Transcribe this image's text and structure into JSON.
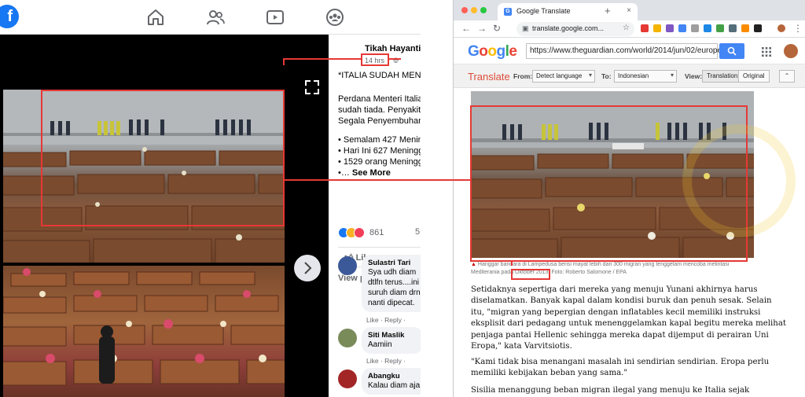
{
  "facebook": {
    "author": "Tikah Hayanti",
    "time": "14 hrs",
    "post_lines": [
      "*ITALIA SUDAH MENT",
      "",
      "Perdana Menteri Italia",
      "sudah tiada. Penyakit",
      "Segala Penyembuhan",
      "",
      "• Semalam 427 Menin",
      "• Hari Ini 627 Meningg",
      "• 1529 orang Meningg",
      "•…"
    ],
    "see_more": "See More",
    "reaction_count": "861",
    "share_count": "5",
    "like_label": "Like",
    "view_previous": "View previous comm",
    "comments": [
      {
        "name": "Sulastri Tari",
        "lines": [
          "Sya udh diam",
          "dtlfn terus....ini",
          "suruh diam drn",
          "nanti dipecat."
        ],
        "actions": "Like · Reply ·"
      },
      {
        "name": "Siti Maslik",
        "lines": [
          "Aamiin"
        ],
        "actions": "Like · Reply ·"
      },
      {
        "name": "Abangku",
        "lines": [
          "Kalau diam aja"
        ],
        "actions": ""
      }
    ]
  },
  "chrome": {
    "tab_title": "Google Translate",
    "tab_close": "×",
    "new_tab": "+",
    "url": "translate.google.com..."
  },
  "translate": {
    "logo": [
      {
        "ch": "G",
        "color": "#4285f4"
      },
      {
        "ch": "o",
        "color": "#ea4335"
      },
      {
        "ch": "o",
        "color": "#fbbc05"
      },
      {
        "ch": "g",
        "color": "#4285f4"
      },
      {
        "ch": "l",
        "color": "#34a853"
      },
      {
        "ch": "e",
        "color": "#ea4335"
      }
    ],
    "source_url": "https://www.theguardian.com/world/2014/jun/02/europe-re",
    "brand": "Translate",
    "from_label": "From:",
    "from_value": "Detect language",
    "to_label": "To:",
    "to_value": "Indonesian",
    "view_label": "View:",
    "translation_btn": "Translation",
    "original_btn": "Original",
    "collapse_icon": "⌃",
    "caption_line1": "Hanggar bandara di Lampedusa berisi mayat lebih dari 300 migran yang tenggelam mencoba melintasi",
    "caption_line2_prefix": "Mediterania pada ",
    "caption_date": "Oktober 2013",
    "caption_line2_suffix": ". Foto: Roberto Salomone / EPA",
    "paragraphs": [
      [
        "Setidaknya sepertiga dari mereka yang menuju Yunani akhirnya harus",
        "diselamatkan. Banyak kapal dalam kondisi buruk dan penuh sesak. Selain",
        "itu, \"migran yang bepergian dengan inflatables kecil memiliki instruksi",
        "eksplisit dari pedagang untuk menenggelamkan kapal begitu mereka melihat",
        "penjaga pantai Hellenic sehingga mereka dapat dijemput di perairan Uni",
        "Eropa,\" kata Varvitsiotis."
      ],
      [
        "\"Kami tidak bisa menangani masalah ini sendirian sendirian. Eropa perlu",
        "memiliki kebijakan beban yang sama.\""
      ],
      [
        "Sisilia menanggung beban migran ilegal yang menuju ke Italia sejak"
      ]
    ]
  },
  "colors": {
    "fb_blue": "#1877f2",
    "highlight_red": "#e53935",
    "google_blue": "#4285f4",
    "translate_red": "#dd4b39",
    "watermark": "#f0c832"
  },
  "icons": [
    "home-icon",
    "friends-icon",
    "watch-icon",
    "groups-icon",
    "expand-icon",
    "chevron-right-icon",
    "globe-icon",
    "search-icon",
    "apps-icon",
    "lock-icon",
    "star-icon"
  ]
}
